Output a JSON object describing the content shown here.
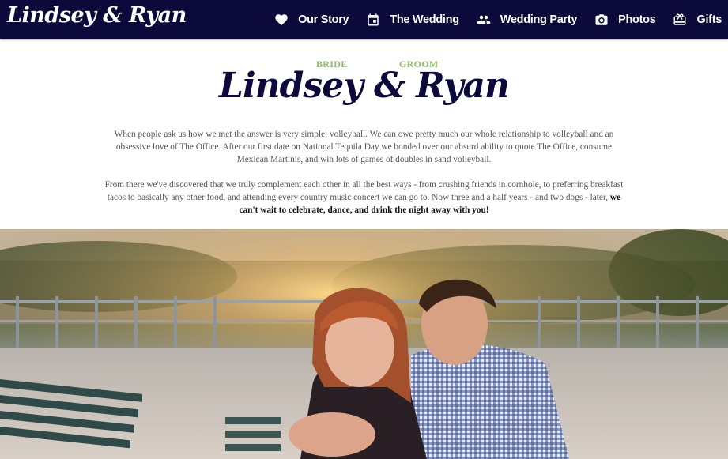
{
  "nav": {
    "brand": "Lindsey & Ryan",
    "items": [
      {
        "label": "Our Story",
        "icon": "heart-icon"
      },
      {
        "label": "The Wedding",
        "icon": "calendar-icon"
      },
      {
        "label": "Wedding Party",
        "icon": "group-icon"
      },
      {
        "label": "Photos",
        "icon": "camera-icon"
      },
      {
        "label": "Gifts",
        "icon": "gift-icon"
      }
    ]
  },
  "intro": {
    "bride_label": "BRIDE",
    "groom_label": "GROOM",
    "title": "Lindsey & Ryan",
    "paragraph1": "When people ask us how we met the answer is very simple: volleyball. We can owe pretty much our whole relationship to volleyball and an obsessive love of The Office. After our first date on National Tequila Day we bonded over our absurd ability to quote The Office, consume Mexican Martinis, and win lots of games of doubles in sand volleyball.",
    "paragraph2_text": "From there we've discovered that we truly complement each other in all the best ways - from crushing friends in cornhole, to preferring breakfast tacos to basically any other food, and attending every country music concert we can go to. Now three and a half years - and two dogs - later,",
    "paragraph2_emphasis": "we can't wait to celebrate, dance, and drink the night away with you!"
  },
  "colors": {
    "navy": "#0c0a3b",
    "green_accent": "#8dbd6d",
    "body_text": "#555555"
  }
}
